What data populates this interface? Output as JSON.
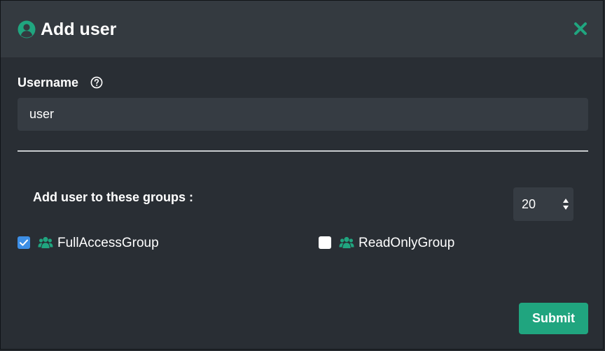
{
  "header": {
    "title": "Add user",
    "icon": "user-circle-icon",
    "close_icon": "close-icon"
  },
  "username": {
    "label": "Username",
    "help_icon": "question-circle-icon",
    "value": "user"
  },
  "groups": {
    "label": "Add user to these groups :",
    "page_size": "20",
    "items": [
      {
        "name": "FullAccessGroup",
        "checked": true,
        "icon": "users-icon"
      },
      {
        "name": "ReadOnlyGroup",
        "checked": false,
        "icon": "users-icon"
      }
    ]
  },
  "actions": {
    "submit_label": "Submit"
  },
  "colors": {
    "accent": "#20a57f",
    "checkbox_checked": "#3d8fe6",
    "header_bg": "#343a40",
    "body_bg": "#292e34",
    "input_bg": "#363c43"
  }
}
